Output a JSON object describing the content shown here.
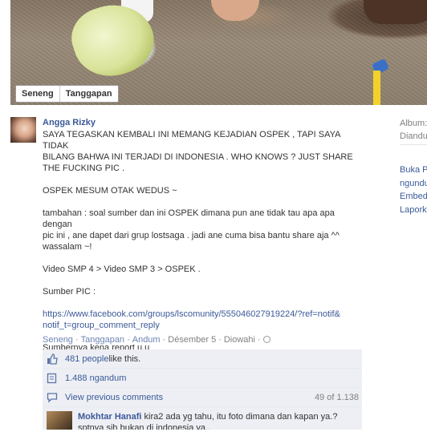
{
  "photo": {
    "tag_buttons": [
      "Seneng",
      "Tanggapan"
    ]
  },
  "sidebar": {
    "album_label": "Album:",
    "album_value": "Diandu",
    "links": [
      "Buka P",
      "ngundu",
      "Embed",
      "Lapork"
    ]
  },
  "post": {
    "author": "Angga Rizky",
    "lines": [
      "SAYA TEGASKAN KEMBALI INI MEMANG KEJADIAN OSPEK , TAPI SAYA TIDAK",
      "BILANG BAHWA INI TERJADI DI INDONESIA . WHO KNOWS ? JUST SHARE",
      "THE FUCKING PIC .",
      "",
      "OSPEK MESUM OTAK WEDUS ~",
      "",
      "tambahan : soal sumber dan ini OSPEK dimana pun ane tidak tau apa apa dengan",
      "pic ini , ane dapet dari grup lostsaga . jadi ane cuma bisa bantu share aja ^^",
      "wassalam ~!",
      "",
      "Video SMP 4 > Video SMP 3 > OSPEK .",
      "",
      "Sumber PIC :",
      ""
    ],
    "link_line1": "https://www.facebook.com/groups/lscomunity/555046027919224/?ref=notif&",
    "link_line2": "notif_t=group_comment_reply",
    "closing": "Sumbernya kena report u.u"
  },
  "actions": {
    "like": "Seneng",
    "comment": "Tanggapan",
    "share": "Andum",
    "date": "Désember 5",
    "seen": "Diowahi"
  },
  "ufi": {
    "likes_link": "481 people",
    "likes_suffix": " like this.",
    "shares": "1.488 ngandum",
    "view_previous": "View previous comments",
    "count": "49 of 1.138"
  },
  "comment": {
    "author": "Mokhtar Hanafi",
    "text1": " kira2 ada yg tahu, itu foto dimana dan kapan ya.?",
    "text2": "sptnya sih bukan di indonesia ya.."
  },
  "colors": {
    "link": "#3b5998",
    "muted": "#808080",
    "ufi_bg": "#edeff4"
  }
}
